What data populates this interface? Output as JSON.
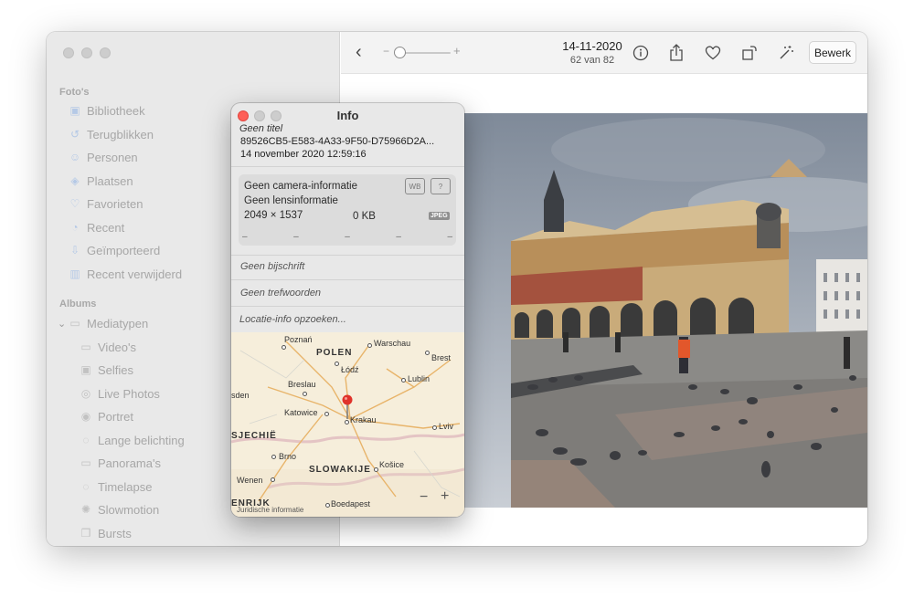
{
  "sidebar": {
    "sections": {
      "photos": "Foto's",
      "albums": "Albums"
    },
    "items": [
      {
        "label": "Bibliotheek",
        "icon": "photo-library-icon"
      },
      {
        "label": "Terugblikken",
        "icon": "memories-icon"
      },
      {
        "label": "Personen",
        "icon": "people-icon"
      },
      {
        "label": "Plaatsen",
        "icon": "places-icon"
      },
      {
        "label": "Favorieten",
        "icon": "heart-icon"
      },
      {
        "label": "Recent",
        "icon": "clock-icon"
      },
      {
        "label": "Geïmporteerd",
        "icon": "import-icon"
      },
      {
        "label": "Recent verwijderd",
        "icon": "trash-icon"
      }
    ],
    "albums_group": "Mediatypen",
    "media_types": [
      {
        "label": "Video's",
        "icon": "video-icon"
      },
      {
        "label": "Selfies",
        "icon": "selfie-icon"
      },
      {
        "label": "Live Photos",
        "icon": "live-photo-icon"
      },
      {
        "label": "Portret",
        "icon": "portrait-icon"
      },
      {
        "label": "Lange belichting",
        "icon": "long-exposure-icon"
      },
      {
        "label": "Panorama's",
        "icon": "panorama-icon"
      },
      {
        "label": "Timelapse",
        "icon": "timelapse-icon"
      },
      {
        "label": "Slowmotion",
        "icon": "slowmo-icon"
      },
      {
        "label": "Bursts",
        "icon": "burst-icon"
      }
    ]
  },
  "toolbar": {
    "date": "14-11-2020",
    "count": "62 van 82",
    "minus": "−",
    "plus": "+",
    "edit_label": "Bewerk"
  },
  "info": {
    "title": "Info",
    "no_title": "Geen titel",
    "filename": "89526CB5-E583-4A33-9F50-D75966D2A...",
    "datetime": "14 november 2020    12:59:16",
    "no_camera": "Geen camera-informatie",
    "no_lens": "Geen lensinformatie",
    "dimensions": "2049 × 1537",
    "size": "0 KB",
    "format": "JPEG",
    "dash": "–",
    "caption": "Geen bijschrift",
    "keywords": "Geen trefwoorden",
    "location": "Locatie-info opzoeken..."
  },
  "map": {
    "labels": {
      "poznan": "Poznań",
      "warschau": "Warschau",
      "polen": "POLEN",
      "lodz": "Łódź",
      "brest": "Brest",
      "breslau": "Breslau",
      "lublin": "Lublin",
      "dresden": "sden",
      "katowice": "Katowice",
      "krakau": "Krakau",
      "tsjechie": "SJECHIË",
      "lviv": "Lviv",
      "brno": "Brno",
      "slowakije": "SLOWAKIJE",
      "kosice": "Košice",
      "wenen": "Wenen",
      "oostenrijk": "ENRIJK",
      "boedapest": "Boedapest",
      "legal": "Juridische informatie"
    },
    "zoom_out": "−",
    "zoom_in": "+"
  },
  "colors": {
    "close": "#fe5f57",
    "inactive": "#c9c9c9",
    "pin": "#e0322a"
  }
}
